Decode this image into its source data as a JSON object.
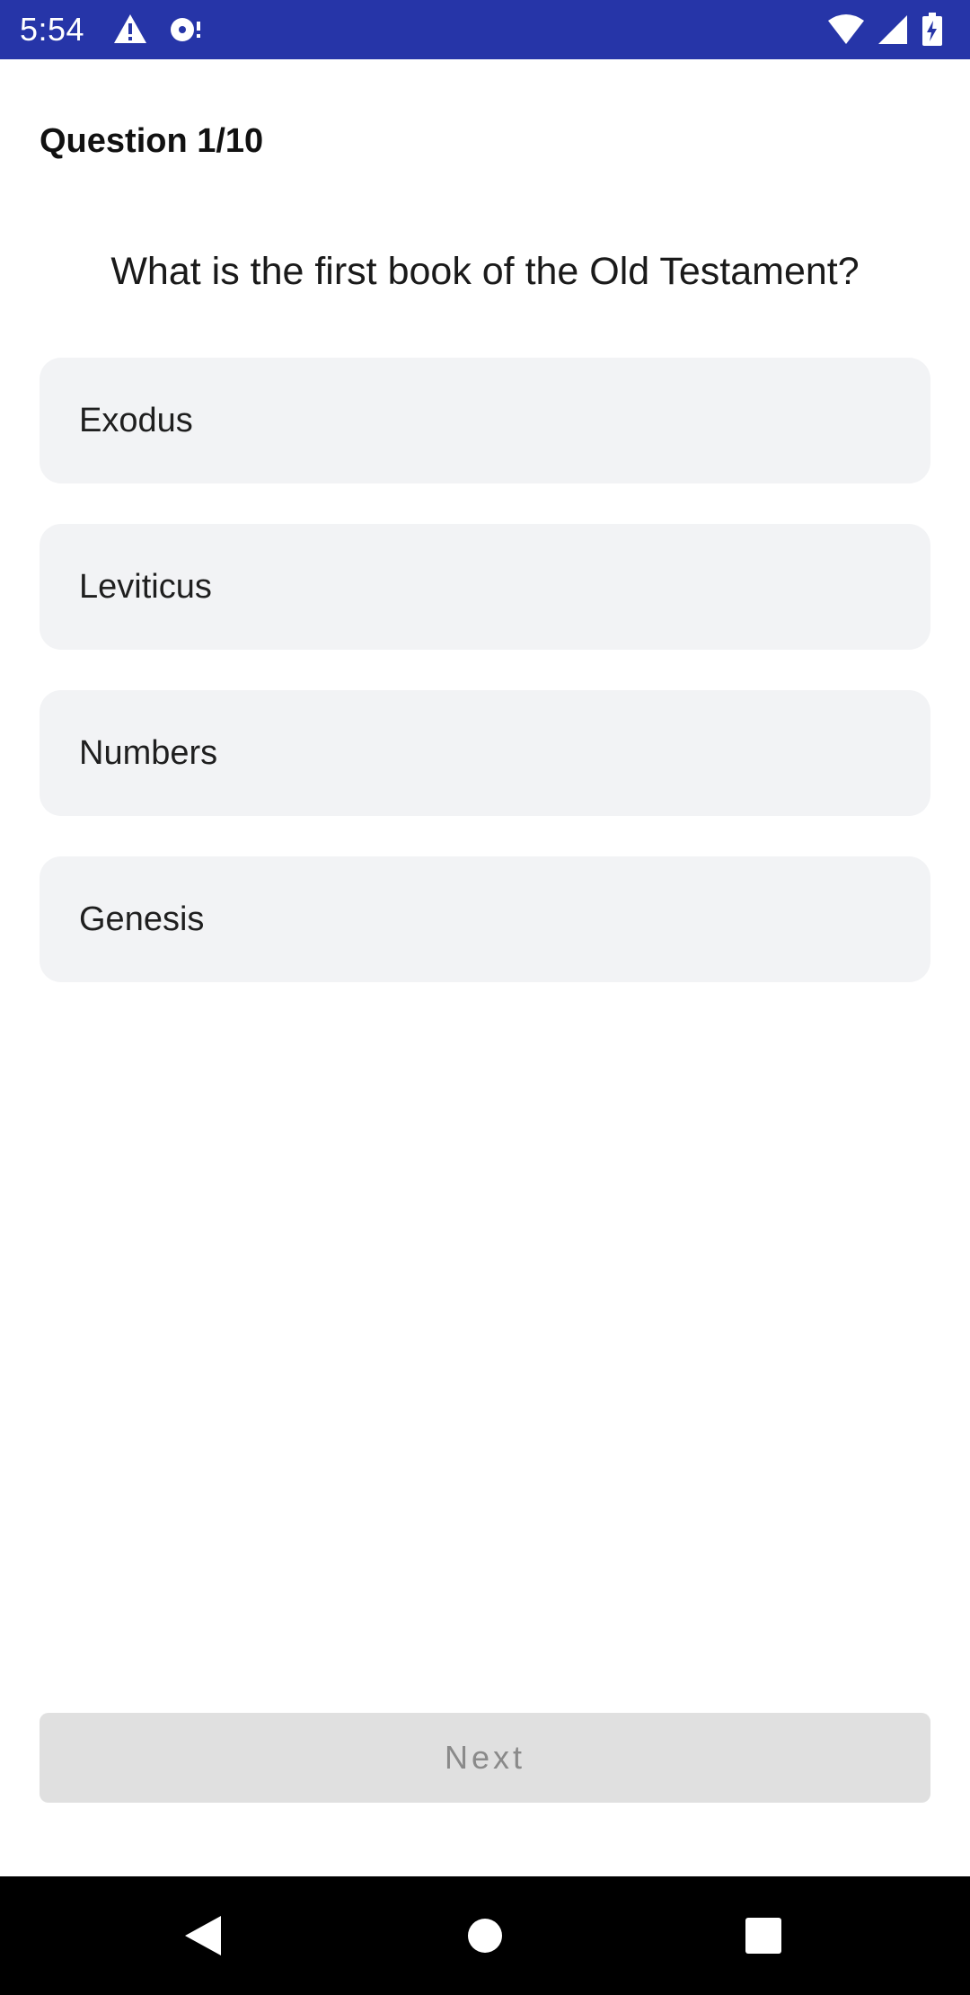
{
  "status_bar": {
    "time": "5:54",
    "icons": [
      "warning-icon",
      "sync-icon",
      "wifi-icon",
      "signal-icon",
      "battery-charging-icon"
    ],
    "background_color": "#2635a8"
  },
  "quiz": {
    "counter": "Question 1/10",
    "question": "What is the first book of the Old Testament?",
    "options": [
      {
        "label": "Exodus"
      },
      {
        "label": "Leviticus"
      },
      {
        "label": "Numbers"
      },
      {
        "label": "Genesis"
      }
    ],
    "next_label": "Next",
    "next_enabled": false
  },
  "nav_bar": {
    "buttons": [
      "back-icon",
      "home-icon",
      "recents-icon"
    ]
  }
}
